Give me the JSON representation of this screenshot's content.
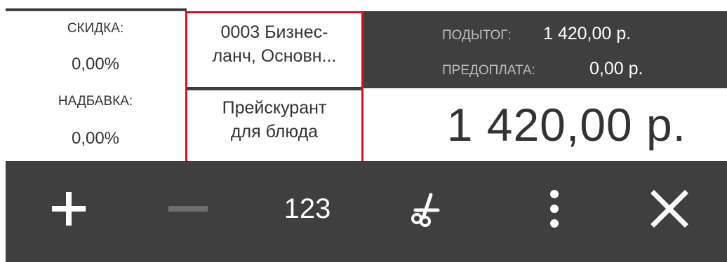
{
  "discount": {
    "label": "СКИДКА:",
    "value": "0,00%"
  },
  "surcharge": {
    "label": "НАДБАВКА:",
    "value": "0,00%"
  },
  "order": {
    "name_line1": "0003 Бизнес-",
    "name_line2": "ланч, Основн...",
    "price_list_line1": "Прейскурант",
    "price_list_line2": "для блюда"
  },
  "totals": {
    "subtotal_label": "ПОДЫТОГ:",
    "subtotal_value": "1 420,00 р.",
    "prepay_label": "ПРЕДОПЛАТА:",
    "prepay_value": "0,00 р.",
    "total": "1 420,00 р."
  },
  "toolbar": {
    "plus_icon": "plus-icon",
    "minus_icon": "minus-icon",
    "quantity_label": "123",
    "scissors_icon": "scissors-icon",
    "more_icon": "more-vertical-icon",
    "close_icon": "close-icon"
  },
  "colors": {
    "accent": "#d0141d",
    "dark": "#3f3f3f",
    "text": "#333333",
    "muted": "#bdbdbd"
  }
}
